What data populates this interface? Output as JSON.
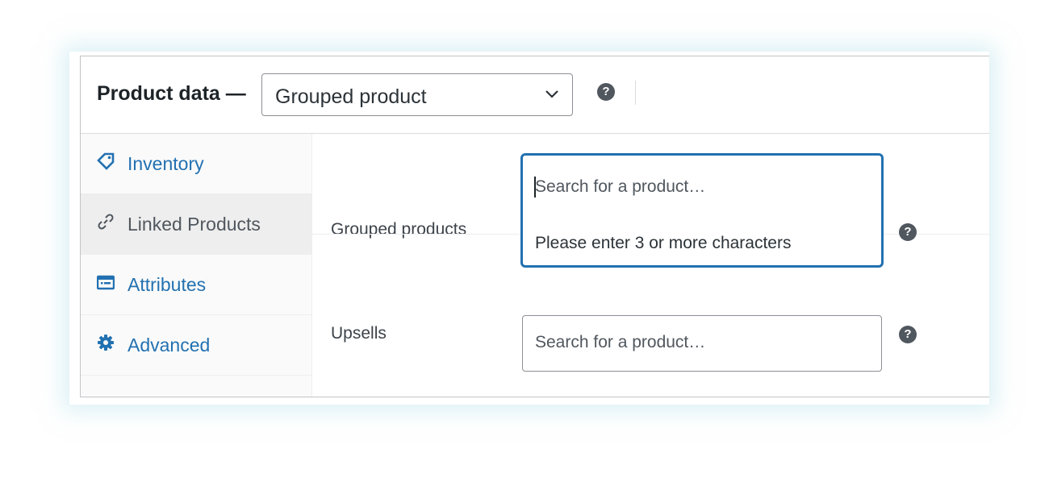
{
  "header": {
    "title": "Product data —",
    "product_type": "Grouped product",
    "help_icon": "question-circle-icon"
  },
  "tabs": [
    {
      "label": "Inventory",
      "icon": "tag-icon",
      "active": false
    },
    {
      "label": "Linked Products",
      "icon": "link-icon",
      "active": true
    },
    {
      "label": "Attributes",
      "icon": "list-table-icon",
      "active": false
    },
    {
      "label": "Advanced",
      "icon": "gear-icon",
      "active": false
    }
  ],
  "fields": {
    "grouped_products": {
      "label": "Grouped products",
      "placeholder": "Search for a product…",
      "dropdown_message": "Please enter 3 or more characters"
    },
    "upsells": {
      "label": "Upsells",
      "placeholder": "Search for a product…"
    }
  },
  "colors": {
    "accent": "#2271b1",
    "active_tab_bg": "#eeeeee",
    "help_icon": "#50575e"
  }
}
